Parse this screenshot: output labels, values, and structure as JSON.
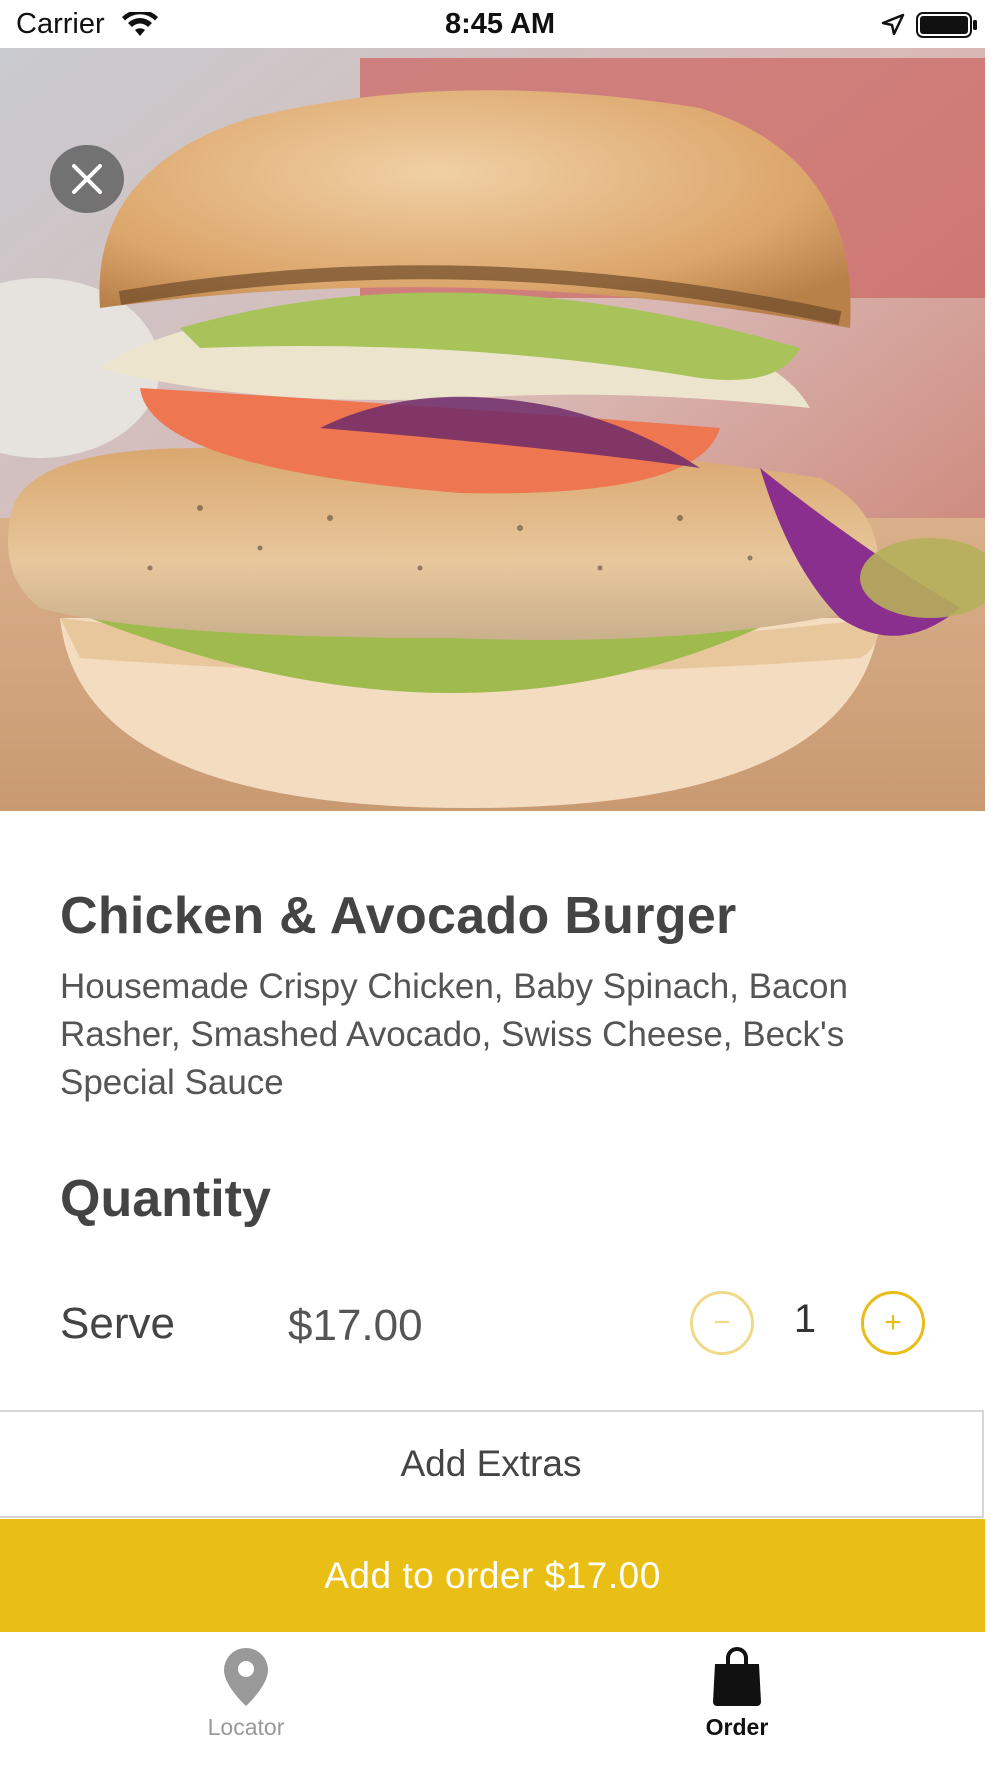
{
  "status_bar": {
    "carrier": "Carrier",
    "time": "8:45 AM",
    "icons": [
      "wifi-icon",
      "location-arrow-icon",
      "battery-icon"
    ]
  },
  "hero": {
    "image": "chicken-avocado-burger-photo",
    "close_icon": "close-icon"
  },
  "item": {
    "title": "Chicken & Avocado Burger",
    "description": "Housemade Crispy Chicken, Baby Spinach, Bacon Rasher, Smashed Avocado, Swiss Cheese, Beck's Special Sauce"
  },
  "quantity": {
    "heading": "Quantity",
    "serve_label": "Serve",
    "price": "$17.00",
    "value": "1",
    "minus_symbol": "−",
    "plus_symbol": "+"
  },
  "actions": {
    "extras_label": "Add Extras",
    "order_label": "Add to order $17.00"
  },
  "tabs": [
    {
      "label": "Locator",
      "icon": "map-pin-icon",
      "active": false
    },
    {
      "label": "Order",
      "icon": "shopping-bag-icon",
      "active": true
    }
  ],
  "colors": {
    "accent": "#e9bf16",
    "accent_disabled": "#f1d98a",
    "text": "#444444",
    "tab_inactive": "#999999"
  }
}
